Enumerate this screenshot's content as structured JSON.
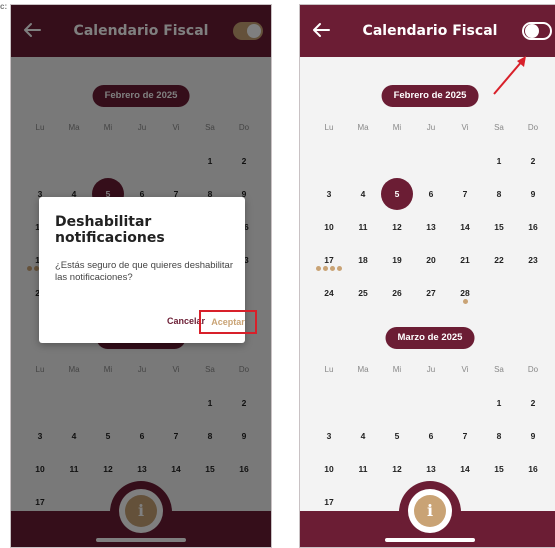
{
  "stray_label": "c:",
  "app": {
    "title": "Calendario Fiscal"
  },
  "weekdays": [
    "Lu",
    "Ma",
    "Mi",
    "Ju",
    "Vi",
    "Sa",
    "Do"
  ],
  "months": [
    {
      "label": "Febrero de 2025",
      "weeks": [
        [
          "",
          "",
          "",
          "",
          "",
          "1",
          "2"
        ],
        [
          "3",
          "4",
          "5",
          "6",
          "7",
          "8",
          "9"
        ],
        [
          "10",
          "11",
          "12",
          "13",
          "14",
          "15",
          "16"
        ],
        [
          "17",
          "18",
          "19",
          "20",
          "21",
          "22",
          "23"
        ],
        [
          "24",
          "25",
          "26",
          "27",
          "28",
          "",
          ""
        ]
      ],
      "today": "5",
      "events": {
        "17": 4,
        "28": 1
      }
    },
    {
      "label": "Marzo de 2025",
      "weeks": [
        [
          "",
          "",
          "",
          "",
          "",
          "1",
          "2"
        ],
        [
          "3",
          "4",
          "5",
          "6",
          "7",
          "8",
          "9"
        ],
        [
          "10",
          "11",
          "12",
          "13",
          "14",
          "15",
          "16"
        ],
        [
          "17",
          "",
          "",
          "",
          "",
          "",
          ""
        ]
      ]
    }
  ],
  "left_screen": {
    "toggle_state": "on"
  },
  "right_screen": {
    "toggle_state": "off"
  },
  "dialog": {
    "title": "Deshabilitar notificaciones",
    "message": "¿Estás seguro de que quieres deshabilitar las notificaciones?",
    "cancel_label": "Cancelar",
    "accept_label": "Aceptar"
  },
  "info_button": {
    "label": "i"
  },
  "colors": {
    "primary": "#6b1d34",
    "accent": "#c9a375",
    "highlight": "#d8202a"
  }
}
